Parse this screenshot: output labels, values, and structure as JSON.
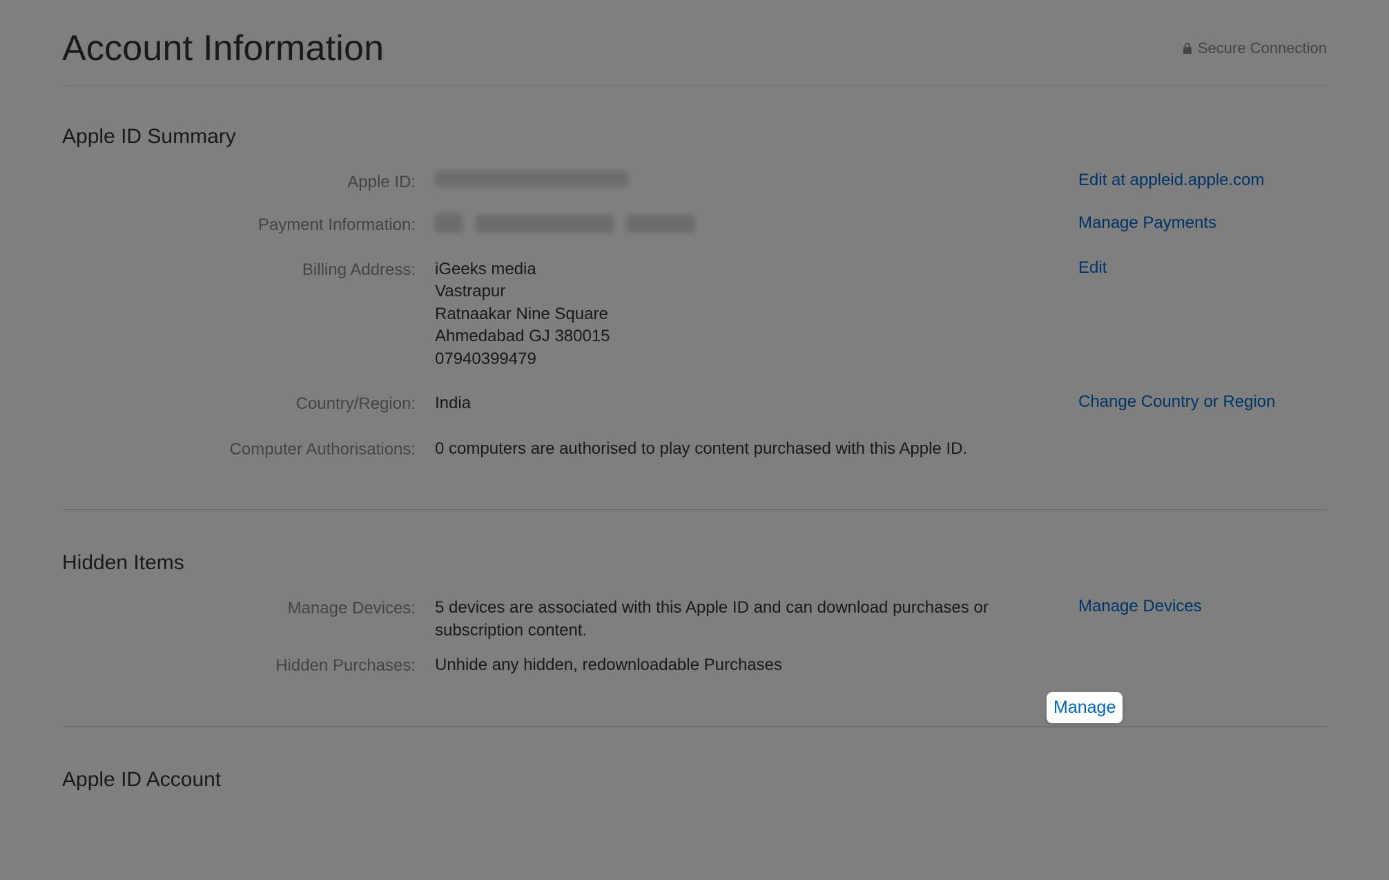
{
  "header": {
    "title": "Account Information",
    "secure_label": "Secure Connection"
  },
  "sections": {
    "apple_id_summary": {
      "title": "Apple ID Summary",
      "rows": {
        "apple_id": {
          "label": "Apple ID:",
          "value_redacted": true,
          "action": "Edit at appleid.apple.com"
        },
        "payment_info": {
          "label": "Payment Information:",
          "value_redacted": true,
          "action": "Manage Payments"
        },
        "billing_address": {
          "label": "Billing Address:",
          "value_lines": [
            "iGeeks media",
            "Vastrapur",
            "Ratnaakar Nine Square",
            "Ahmedabad GJ 380015",
            "07940399479"
          ],
          "action": "Edit"
        },
        "country_region": {
          "label": "Country/Region:",
          "value": "India",
          "action": "Change Country or Region"
        },
        "computer_auth": {
          "label": "Computer Authorisations:",
          "value": "0 computers are authorised to play content purchased with this Apple ID."
        }
      }
    },
    "hidden_items": {
      "title": "Hidden Items",
      "rows": {
        "manage_devices": {
          "label": "Manage Devices:",
          "value": "5 devices are associated with this Apple ID and can download purchases or subscription content.",
          "action": "Manage Devices"
        },
        "hidden_purchases": {
          "label": "Hidden Purchases:",
          "value": "Unhide any hidden, redownloadable Purchases",
          "action": "Manage"
        }
      }
    },
    "apple_id_account": {
      "title": "Apple ID Account"
    }
  }
}
